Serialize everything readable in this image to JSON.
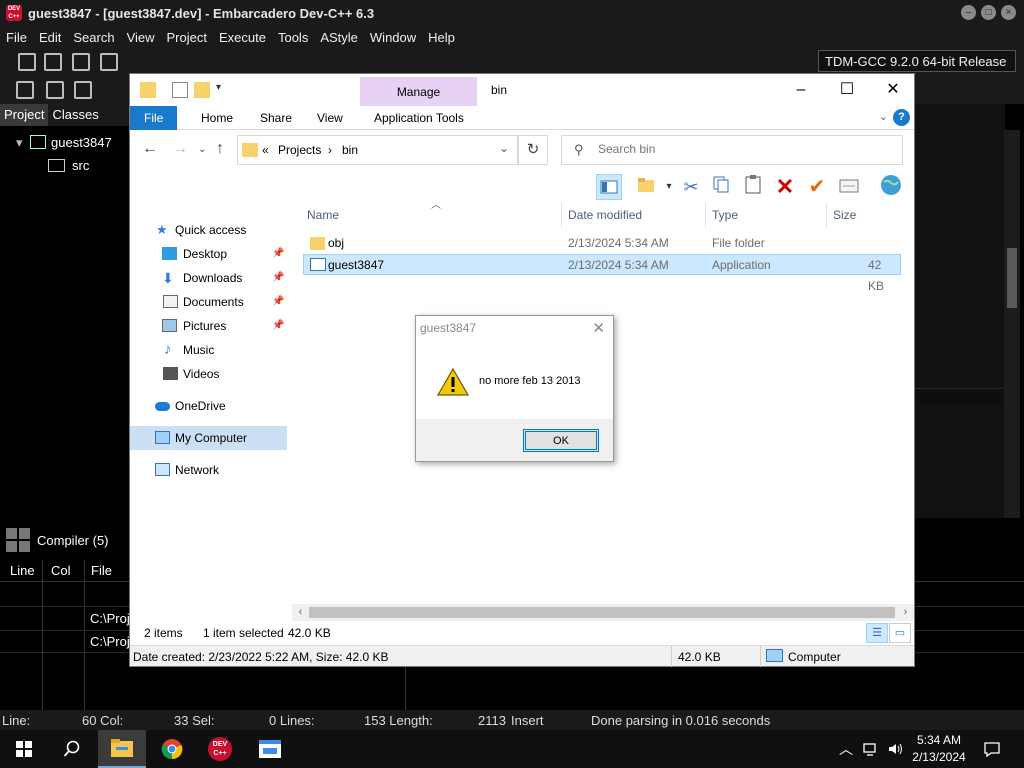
{
  "ide": {
    "title": "guest3847 - [guest3847.dev] - Embarcadero Dev-C++ 6.3",
    "logo_text": "DEV C++",
    "menu": [
      "File",
      "Edit",
      "Search",
      "View",
      "Project",
      "Execute",
      "Tools",
      "AStyle",
      "Window",
      "Help"
    ],
    "compiler": "TDM-GCC 9.2.0 64-bit Release",
    "left_tabs": [
      "Project",
      "Classes"
    ],
    "tree": {
      "root": "guest3847",
      "child": "src"
    },
    "bottom_tab": "Compiler (5)",
    "grid_headers": [
      "Line",
      "Col",
      "File"
    ],
    "grid_cells": [
      "C:\\Proj",
      "C:\\Proj"
    ],
    "status": {
      "line": "Line:",
      "line_val": "60 Col:",
      "col_val": "33 Sel:",
      "sel_val": "0 Lines:",
      "lines_val": "153 Length:",
      "length_val": "2113",
      "mode": "Insert",
      "msg": "Done parsing in 0.016 seconds"
    }
  },
  "explorer": {
    "manage_tab": "Manage",
    "path_title": "bin",
    "ribbon_tabs": [
      "File",
      "Home",
      "Share",
      "View",
      "Application Tools"
    ],
    "help": "?",
    "address": {
      "prefix": "«",
      "parts": [
        "Projects",
        "bin"
      ]
    },
    "search": {
      "placeholder": "Search bin",
      "value": ""
    },
    "nav": [
      {
        "label": "Quick access",
        "icon": "star-icon"
      },
      {
        "label": "Desktop",
        "icon": "desktop-icon",
        "pinned": true
      },
      {
        "label": "Downloads",
        "icon": "download-icon",
        "pinned": true
      },
      {
        "label": "Documents",
        "icon": "documents-icon",
        "pinned": true
      },
      {
        "label": "Pictures",
        "icon": "pictures-icon",
        "pinned": true
      },
      {
        "label": "Music",
        "icon": "music-icon"
      },
      {
        "label": "Videos",
        "icon": "videos-icon"
      },
      {
        "label": "OneDrive",
        "icon": "cloud-icon"
      },
      {
        "label": "My Computer",
        "icon": "computer-icon",
        "selected": true
      },
      {
        "label": "Network",
        "icon": "network-icon"
      }
    ],
    "columns": [
      "Name",
      "Date modified",
      "Type",
      "Size"
    ],
    "files": [
      {
        "name": "obj",
        "date": "2/13/2024 5:34 AM",
        "type": "File folder",
        "size": "",
        "icon": "folder-icon"
      },
      {
        "name": "guest3847",
        "date": "2/13/2024 5:34 AM",
        "type": "Application",
        "size": "42 KB",
        "icon": "application-icon",
        "selected": true
      }
    ],
    "status": {
      "items": "2 items",
      "selected": "1 item selected",
      "size": "42.0 KB"
    },
    "details_bar": {
      "info": "Date created: 2/23/2022 5:22 AM, Size: 42.0 KB",
      "size": "42.0 KB",
      "location": "Computer"
    }
  },
  "msgbox": {
    "title": "guest3847",
    "text": "no more feb 13 2013",
    "ok": "OK"
  },
  "taskbar": {
    "time": "5:34 AM",
    "date": "2/13/2024",
    "devcpp_label": "DEV C++"
  },
  "colors": {
    "accent": "#1979ca",
    "manage_tab": "#e7d2f5",
    "selection": "#cce8ff",
    "warning": "#f2c811"
  }
}
